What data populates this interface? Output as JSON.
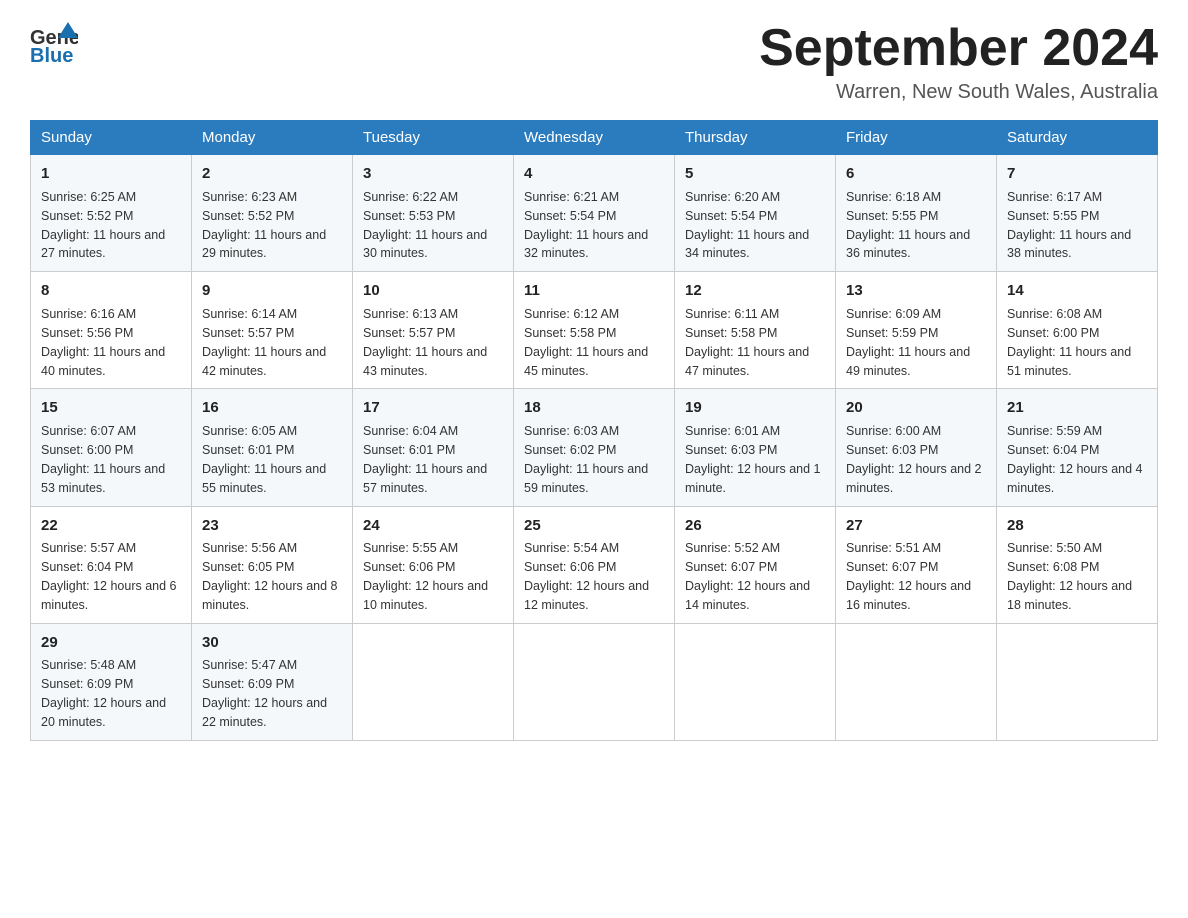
{
  "header": {
    "logo_general": "General",
    "logo_blue": "Blue",
    "month_title": "September 2024",
    "location": "Warren, New South Wales, Australia"
  },
  "calendar": {
    "days_of_week": [
      "Sunday",
      "Monday",
      "Tuesday",
      "Wednesday",
      "Thursday",
      "Friday",
      "Saturday"
    ],
    "weeks": [
      [
        {
          "day": "1",
          "sunrise": "6:25 AM",
          "sunset": "5:52 PM",
          "daylight": "11 hours and 27 minutes."
        },
        {
          "day": "2",
          "sunrise": "6:23 AM",
          "sunset": "5:52 PM",
          "daylight": "11 hours and 29 minutes."
        },
        {
          "day": "3",
          "sunrise": "6:22 AM",
          "sunset": "5:53 PM",
          "daylight": "11 hours and 30 minutes."
        },
        {
          "day": "4",
          "sunrise": "6:21 AM",
          "sunset": "5:54 PM",
          "daylight": "11 hours and 32 minutes."
        },
        {
          "day": "5",
          "sunrise": "6:20 AM",
          "sunset": "5:54 PM",
          "daylight": "11 hours and 34 minutes."
        },
        {
          "day": "6",
          "sunrise": "6:18 AM",
          "sunset": "5:55 PM",
          "daylight": "11 hours and 36 minutes."
        },
        {
          "day": "7",
          "sunrise": "6:17 AM",
          "sunset": "5:55 PM",
          "daylight": "11 hours and 38 minutes."
        }
      ],
      [
        {
          "day": "8",
          "sunrise": "6:16 AM",
          "sunset": "5:56 PM",
          "daylight": "11 hours and 40 minutes."
        },
        {
          "day": "9",
          "sunrise": "6:14 AM",
          "sunset": "5:57 PM",
          "daylight": "11 hours and 42 minutes."
        },
        {
          "day": "10",
          "sunrise": "6:13 AM",
          "sunset": "5:57 PM",
          "daylight": "11 hours and 43 minutes."
        },
        {
          "day": "11",
          "sunrise": "6:12 AM",
          "sunset": "5:58 PM",
          "daylight": "11 hours and 45 minutes."
        },
        {
          "day": "12",
          "sunrise": "6:11 AM",
          "sunset": "5:58 PM",
          "daylight": "11 hours and 47 minutes."
        },
        {
          "day": "13",
          "sunrise": "6:09 AM",
          "sunset": "5:59 PM",
          "daylight": "11 hours and 49 minutes."
        },
        {
          "day": "14",
          "sunrise": "6:08 AM",
          "sunset": "6:00 PM",
          "daylight": "11 hours and 51 minutes."
        }
      ],
      [
        {
          "day": "15",
          "sunrise": "6:07 AM",
          "sunset": "6:00 PM",
          "daylight": "11 hours and 53 minutes."
        },
        {
          "day": "16",
          "sunrise": "6:05 AM",
          "sunset": "6:01 PM",
          "daylight": "11 hours and 55 minutes."
        },
        {
          "day": "17",
          "sunrise": "6:04 AM",
          "sunset": "6:01 PM",
          "daylight": "11 hours and 57 minutes."
        },
        {
          "day": "18",
          "sunrise": "6:03 AM",
          "sunset": "6:02 PM",
          "daylight": "11 hours and 59 minutes."
        },
        {
          "day": "19",
          "sunrise": "6:01 AM",
          "sunset": "6:03 PM",
          "daylight": "12 hours and 1 minute."
        },
        {
          "day": "20",
          "sunrise": "6:00 AM",
          "sunset": "6:03 PM",
          "daylight": "12 hours and 2 minutes."
        },
        {
          "day": "21",
          "sunrise": "5:59 AM",
          "sunset": "6:04 PM",
          "daylight": "12 hours and 4 minutes."
        }
      ],
      [
        {
          "day": "22",
          "sunrise": "5:57 AM",
          "sunset": "6:04 PM",
          "daylight": "12 hours and 6 minutes."
        },
        {
          "day": "23",
          "sunrise": "5:56 AM",
          "sunset": "6:05 PM",
          "daylight": "12 hours and 8 minutes."
        },
        {
          "day": "24",
          "sunrise": "5:55 AM",
          "sunset": "6:06 PM",
          "daylight": "12 hours and 10 minutes."
        },
        {
          "day": "25",
          "sunrise": "5:54 AM",
          "sunset": "6:06 PM",
          "daylight": "12 hours and 12 minutes."
        },
        {
          "day": "26",
          "sunrise": "5:52 AM",
          "sunset": "6:07 PM",
          "daylight": "12 hours and 14 minutes."
        },
        {
          "day": "27",
          "sunrise": "5:51 AM",
          "sunset": "6:07 PM",
          "daylight": "12 hours and 16 minutes."
        },
        {
          "day": "28",
          "sunrise": "5:50 AM",
          "sunset": "6:08 PM",
          "daylight": "12 hours and 18 minutes."
        }
      ],
      [
        {
          "day": "29",
          "sunrise": "5:48 AM",
          "sunset": "6:09 PM",
          "daylight": "12 hours and 20 minutes."
        },
        {
          "day": "30",
          "sunrise": "5:47 AM",
          "sunset": "6:09 PM",
          "daylight": "12 hours and 22 minutes."
        },
        null,
        null,
        null,
        null,
        null
      ]
    ]
  }
}
